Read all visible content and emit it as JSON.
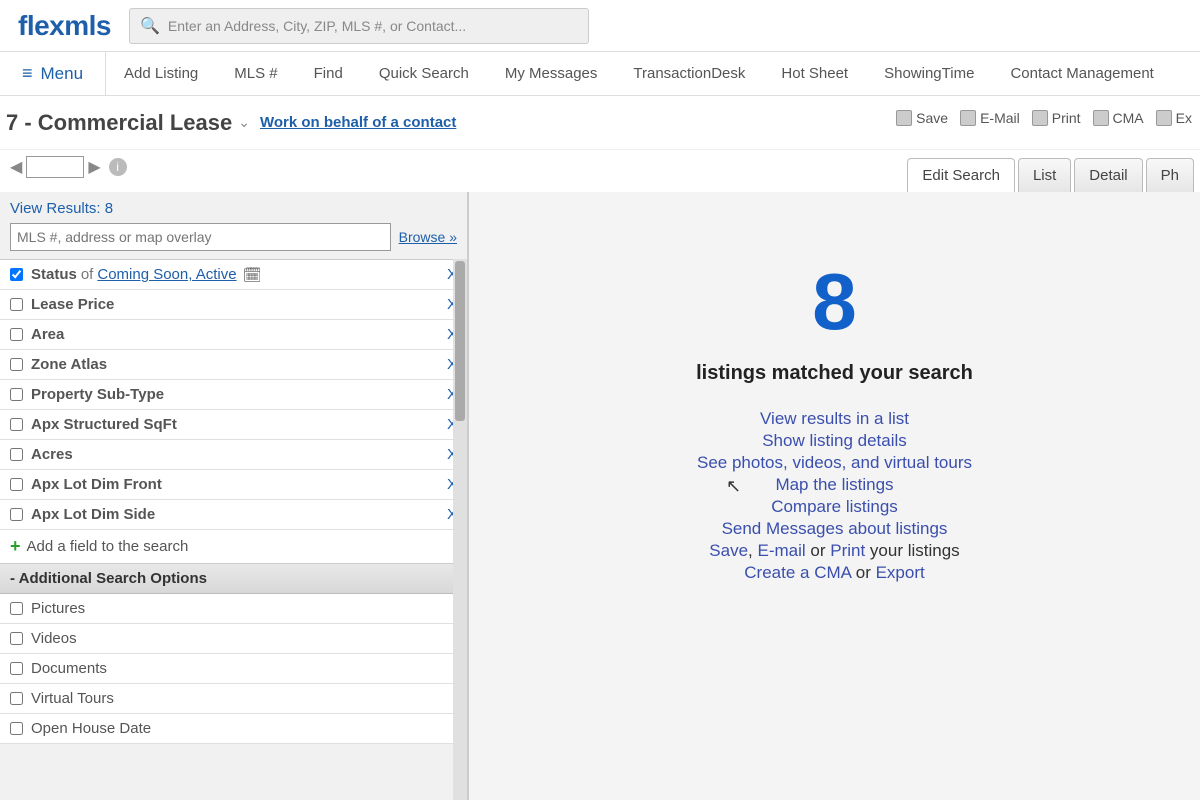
{
  "logo": "flexmls",
  "search_placeholder": "Enter an Address, City, ZIP, MLS #, or Contact...",
  "menu_label": "Menu",
  "nav": [
    "Add Listing",
    "MLS #",
    "Find",
    "Quick Search",
    "My Messages",
    "TransactionDesk",
    "Hot Sheet",
    "ShowingTime",
    "Contact Management"
  ],
  "page_title": "7 - Commercial Lease",
  "behalf_link": "Work on behalf of a contact",
  "actions": [
    {
      "name": "save",
      "label": "Save"
    },
    {
      "name": "email",
      "label": "E-Mail"
    },
    {
      "name": "print",
      "label": "Print"
    },
    {
      "name": "cma",
      "label": "CMA"
    },
    {
      "name": "export",
      "label": "Ex"
    }
  ],
  "tabs": [
    {
      "label": "Edit Search",
      "active": true
    },
    {
      "label": "List",
      "active": false
    },
    {
      "label": "Detail",
      "active": false
    },
    {
      "label": "Ph",
      "active": false
    }
  ],
  "view_results_label": "View Results: 8",
  "filter_placeholder": "MLS #, address or map overlay",
  "browse_label": "Browse »",
  "status_field": {
    "label": "Status",
    "of": "of",
    "value": "Coming Soon, Active",
    "checked": true
  },
  "fields": [
    "Lease Price",
    "Area",
    "Zone Atlas",
    "Property Sub-Type",
    "Apx Structured SqFt",
    "Acres",
    "Apx Lot Dim Front",
    "Apx Lot Dim Side"
  ],
  "add_field_label": "Add a field to the search",
  "aso_header": "- Additional Search Options",
  "aso_fields": [
    "Pictures",
    "Videos",
    "Documents",
    "Virtual Tours",
    "Open House Date"
  ],
  "results": {
    "count": "8",
    "matched_text": "listings matched your search",
    "lines": [
      [
        {
          "t": "View results in a list",
          "link": true
        }
      ],
      [
        {
          "t": "Show listing details",
          "link": true
        }
      ],
      [
        {
          "t": "See photos, videos, and virtual tours",
          "link": true
        }
      ],
      [
        {
          "t": "Map the listings",
          "link": true
        }
      ],
      [
        {
          "t": "Compare listings",
          "link": true
        }
      ],
      [
        {
          "t": "Send Messages about listings",
          "link": true
        }
      ],
      [
        {
          "t": "Save",
          "link": true
        },
        {
          "t": ", ",
          "link": false
        },
        {
          "t": "E-mail",
          "link": true
        },
        {
          "t": " or ",
          "link": false
        },
        {
          "t": "Print",
          "link": true
        },
        {
          "t": " your listings",
          "link": false
        }
      ],
      [
        {
          "t": "Create a CMA",
          "link": true
        },
        {
          "t": " or ",
          "link": false
        },
        {
          "t": "Export",
          "link": true
        }
      ]
    ]
  }
}
